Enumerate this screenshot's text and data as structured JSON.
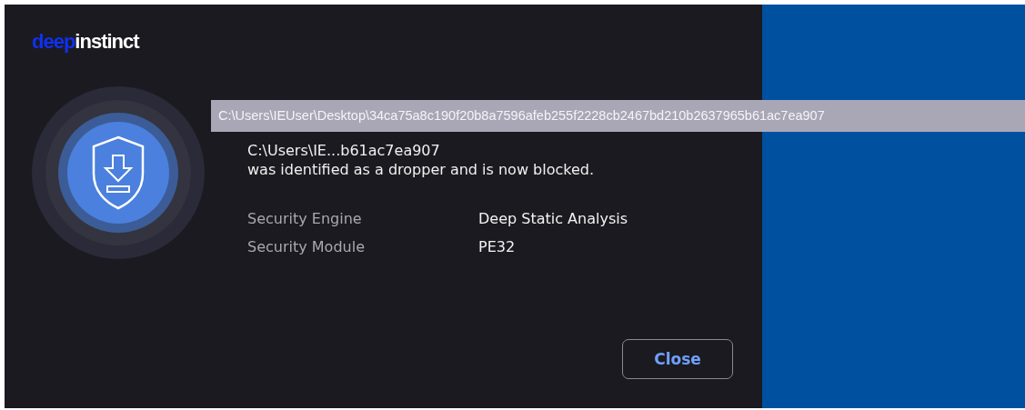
{
  "logo": {
    "accent": "deep",
    "rest": "instinct"
  },
  "tooltip": "C:\\Users\\IEUser\\Desktop\\34ca75a8c190f20b8a7596afeb255f2228cb2467bd210b2637965b61ac7ea907",
  "message": {
    "file": "C:\\Users\\IE...b61ac7ea907",
    "text": "was identified as a dropper and is now blocked."
  },
  "details": [
    {
      "label": "Security Engine",
      "value": "Deep Static Analysis"
    },
    {
      "label": "Security Module",
      "value": "PE32"
    }
  ],
  "buttons": [
    "Close"
  ]
}
